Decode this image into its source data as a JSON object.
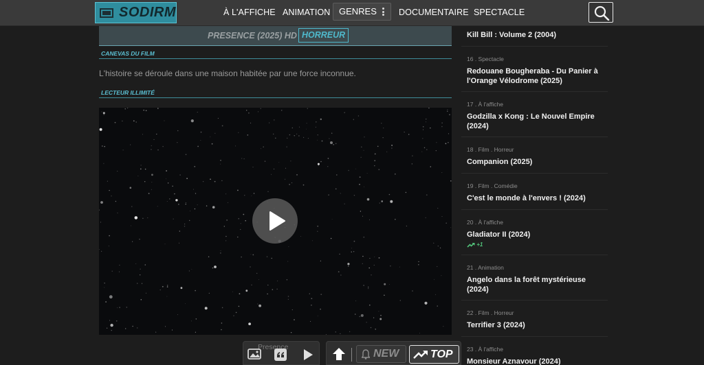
{
  "header": {
    "logo_text": "SODIRM",
    "nav": [
      "À L'AFFICHE",
      "ANIMATION",
      "GENRES",
      "DOCUMENTAIRE",
      "SPECTACLE"
    ],
    "search_icon": "search-icon"
  },
  "movie": {
    "title": "PRESENCE (2025)",
    "quality": "HD",
    "genre": "HORREUR",
    "synopsis_label": "CANEVAS DU FILM",
    "synopsis": "L'histoire se déroule dans une maison habitée par une force inconnue.",
    "player_label": "LECTEUR ILLIMITÉ"
  },
  "toolbar": {
    "ghost_title": "Presence",
    "new_label": "NEW",
    "top_label": "TOP"
  },
  "sidebar": {
    "items": [
      {
        "meta": "",
        "title": "Kill Bill : Volume 2 (2004)"
      },
      {
        "meta": "16 . Spectacle",
        "title": "Redouane Bougheraba - Du Panier à l'Orange Vélodrome (2025)"
      },
      {
        "meta": "17 . À l'affiche",
        "title": "Godzilla x Kong : Le Nouvel Empire (2024)"
      },
      {
        "meta": "18 . Film . Horreur",
        "title": "Companion (2025)"
      },
      {
        "meta": "19 . Film . Comédie",
        "title": "C'est le monde à l'envers ! (2024)"
      },
      {
        "meta": "20 . À l'affiche",
        "title": "Gladiator II (2024)",
        "trend": "+1"
      },
      {
        "meta": "21 . Animation",
        "title": "Angelo dans la forêt mystérieuse (2024)"
      },
      {
        "meta": "22 . Film . Horreur",
        "title": "Terrifier 3 (2024)"
      },
      {
        "meta": "23 . À l'affiche",
        "title": "Monsieur Aznavour (2024)"
      }
    ]
  },
  "colors": {
    "accent": "#4fb9cc",
    "logo_bg": "#2f8d9e",
    "trend_up": "#52c27a"
  }
}
